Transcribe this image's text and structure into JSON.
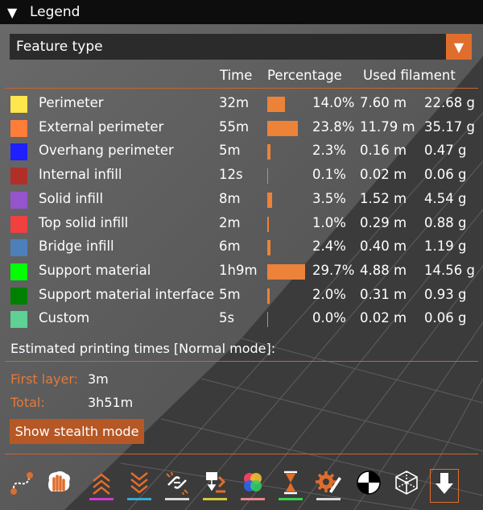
{
  "panel": {
    "title": "Legend",
    "collapse_glyph": "▼"
  },
  "view_select": {
    "value": "Feature type",
    "dropdown_icon": "triangle-down-icon",
    "glyph": "▼"
  },
  "table": {
    "headers": {
      "time": "Time",
      "percentage": "Percentage",
      "used_filament": "Used filament"
    },
    "rows": [
      {
        "name": "Perimeter",
        "color": "#ffe64d",
        "time": "32m",
        "pct": "14.0%",
        "pct_value": 14.0,
        "length": "7.60 m",
        "weight": "22.68 g"
      },
      {
        "name": "External perimeter",
        "color": "#ff7d38",
        "time": "55m",
        "pct": "23.8%",
        "pct_value": 23.8,
        "length": "11.79 m",
        "weight": "35.17 g"
      },
      {
        "name": "Overhang perimeter",
        "color": "#1f1fff",
        "time": "5m",
        "pct": "2.3%",
        "pct_value": 2.3,
        "length": "0.16 m",
        "weight": "0.47 g"
      },
      {
        "name": "Internal infill",
        "color": "#b03029",
        "time": "12s",
        "pct": "0.1%",
        "pct_value": 0.1,
        "length": "0.02 m",
        "weight": "0.06 g"
      },
      {
        "name": "Solid infill",
        "color": "#9654cc",
        "time": "8m",
        "pct": "3.5%",
        "pct_value": 3.5,
        "length": "1.52 m",
        "weight": "4.54 g"
      },
      {
        "name": "Top solid infill",
        "color": "#f04040",
        "time": "2m",
        "pct": "1.0%",
        "pct_value": 1.0,
        "length": "0.29 m",
        "weight": "0.88 g"
      },
      {
        "name": "Bridge infill",
        "color": "#4d80ba",
        "time": "6m",
        "pct": "2.4%",
        "pct_value": 2.4,
        "length": "0.40 m",
        "weight": "1.19 g"
      },
      {
        "name": "Support material",
        "color": "#00ff00",
        "time": "1h9m",
        "pct": "29.7%",
        "pct_value": 29.7,
        "length": "4.88 m",
        "weight": "14.56 g"
      },
      {
        "name": "Support material interface",
        "color": "#008000",
        "time": "5m",
        "pct": "2.0%",
        "pct_value": 2.0,
        "length": "0.31 m",
        "weight": "0.93 g"
      },
      {
        "name": "Custom",
        "color": "#5ed194",
        "time": "5s",
        "pct": "0.0%",
        "pct_value": 0.0,
        "length": "0.02 m",
        "weight": "0.06 g"
      }
    ]
  },
  "estimates": {
    "heading": "Estimated printing times [Normal mode]:",
    "first_layer_label": "First layer:",
    "first_layer_value": "3m",
    "total_label": "Total:",
    "total_value": "3h51m",
    "stealth_button": "Show stealth mode"
  },
  "toolbar": {
    "items": [
      {
        "name": "travel-icon",
        "underline": ""
      },
      {
        "name": "wipe-icon",
        "underline": ""
      },
      {
        "name": "retractions-icon",
        "underline": "#d13bd1"
      },
      {
        "name": "deretractions-icon",
        "underline": "#3ba7d1"
      },
      {
        "name": "seams-icon",
        "underline": "#d9d9d9"
      },
      {
        "name": "tool-changes-icon",
        "underline": "#d1c83b"
      },
      {
        "name": "color-changes-icon",
        "underline": "#e8878a"
      },
      {
        "name": "pause-prints-icon",
        "underline": "#3bd14f"
      },
      {
        "name": "custom-gcodes-icon",
        "underline": "#d9d9d9"
      },
      {
        "name": "center-of-gravity-icon",
        "underline": ""
      },
      {
        "name": "shells-icon",
        "underline": ""
      },
      {
        "name": "tool-marker-icon",
        "underline": ""
      }
    ]
  }
}
